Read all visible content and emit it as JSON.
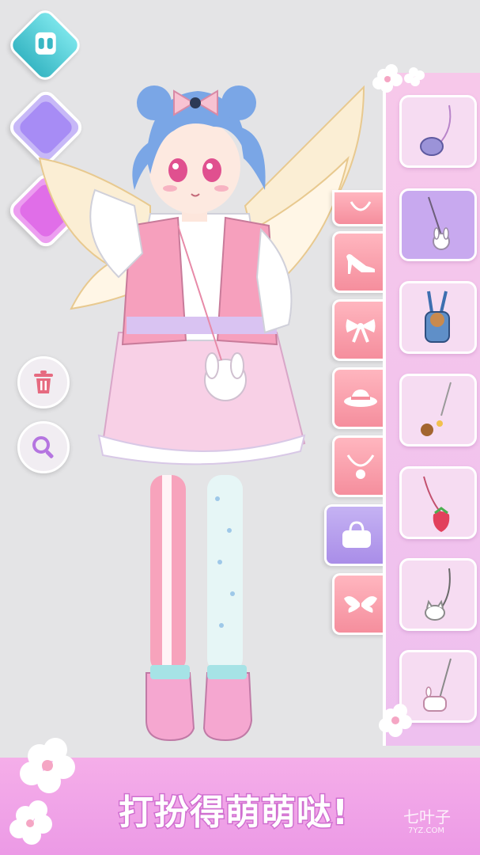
{
  "banner": {
    "slogan": "打扮得萌萌哒!"
  },
  "watermark": {
    "brand": "七叶子",
    "domain": "7YZ.COM"
  },
  "left_toolbar": [
    {
      "name": "wardrobe-button",
      "icon": "wardrobe-icon",
      "color": "#4fcfd6"
    },
    {
      "name": "color-swatch-purple",
      "icon": "color-swatch",
      "color": "#a78cf5"
    },
    {
      "name": "color-swatch-magenta",
      "icon": "color-swatch",
      "color": "#e06ee8"
    },
    {
      "name": "delete-button",
      "icon": "trash-icon"
    },
    {
      "name": "zoom-button",
      "icon": "magnifier-icon"
    }
  ],
  "categories": [
    {
      "name": "necklace",
      "icon": "necklace-icon"
    },
    {
      "name": "shoes",
      "icon": "high-heel-icon"
    },
    {
      "name": "bow",
      "icon": "bow-icon"
    },
    {
      "name": "hat",
      "icon": "hat-icon"
    },
    {
      "name": "jewelry",
      "icon": "pendant-icon"
    },
    {
      "name": "bag",
      "icon": "handbag-icon",
      "active": true
    },
    {
      "name": "wings",
      "icon": "wings-icon"
    }
  ],
  "bag_items": [
    {
      "name": "coin-purse",
      "icon": "purple-coin-purse-icon"
    },
    {
      "name": "bunny-bag",
      "icon": "white-bunny-bag-icon",
      "selected": true
    },
    {
      "name": "bear-backpack",
      "icon": "bear-backpack-icon"
    },
    {
      "name": "bear-charm",
      "icon": "bear-charm-icon"
    },
    {
      "name": "strawberry-bag",
      "icon": "strawberry-bag-icon"
    },
    {
      "name": "cat-bag",
      "icon": "cat-bag-icon"
    },
    {
      "name": "bunny-purse",
      "icon": "bunny-purse-icon"
    }
  ],
  "colors": {
    "accent_pink": "#f58e9d",
    "accent_purple": "#a98de8",
    "banner": "#ec9ae6",
    "hair": "#7aa6e6"
  }
}
